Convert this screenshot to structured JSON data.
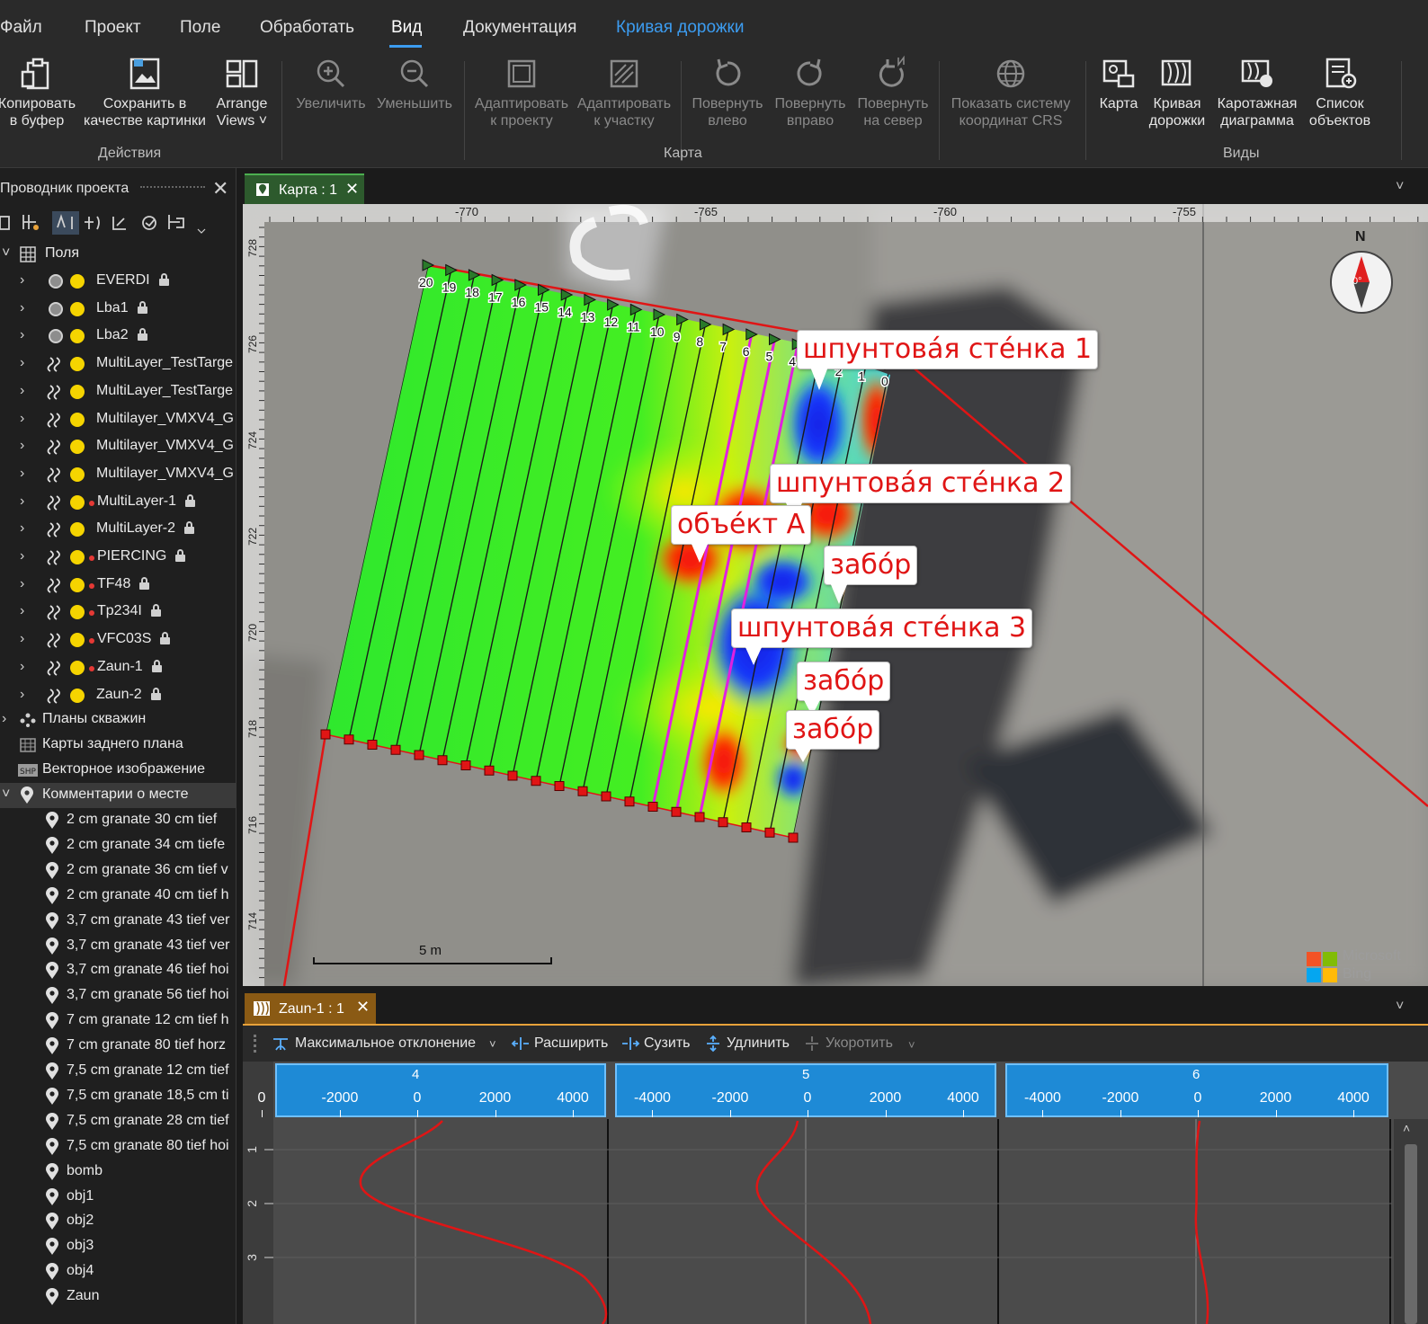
{
  "menu": {
    "items": [
      "Файл",
      "Проект",
      "Поле",
      "Обработать",
      "Вид",
      "Документация",
      "Кривая дорожки"
    ],
    "active": "Вид",
    "accent": "Кривая дорожки"
  },
  "ribbon": {
    "actions": {
      "copy": "Копировать\nв буфер",
      "save_image": "Сохранить в\nкачестве картинки",
      "arrange": "Arrange\nViews ˅",
      "group": "Действия"
    },
    "map": {
      "zoom_in": "Увеличить",
      "zoom_out": "Уменьшить",
      "fit_project": "Адаптировать\nк проекту",
      "fit_field": "Адаптировать\nк участку",
      "rotate_left": "Повернуть\nвлево",
      "rotate_right": "Повернуть\nвправо",
      "rotate_north": "Повернуть\nна север",
      "show_crs": "Показать систему\nкоординат CRS",
      "group": "Карта"
    },
    "views": {
      "map": "Карта",
      "track_curve": "Кривая\nдорожки",
      "log_chart": "Каротажная\nдиаграмма",
      "object_list": "Список\nобъектов",
      "group": "Виды"
    }
  },
  "sidebar": {
    "title": "Проводник проекта",
    "fields_label": "Поля",
    "fields": [
      {
        "name": "EVERDI",
        "kind": "grid",
        "red": false,
        "locked": true
      },
      {
        "name": "Lba1",
        "kind": "grid",
        "red": false,
        "locked": true
      },
      {
        "name": "Lba2",
        "kind": "grid",
        "red": false,
        "locked": true
      },
      {
        "name": "MultiLayer_TestTarge",
        "kind": "wave",
        "red": false,
        "locked": false
      },
      {
        "name": "MultiLayer_TestTarge",
        "kind": "wave",
        "red": false,
        "locked": false
      },
      {
        "name": "Multilayer_VMXV4_G",
        "kind": "wave",
        "red": false,
        "locked": false
      },
      {
        "name": "Multilayer_VMXV4_G",
        "kind": "wave",
        "red": false,
        "locked": false
      },
      {
        "name": "Multilayer_VMXV4_G",
        "kind": "wave",
        "red": false,
        "locked": false
      },
      {
        "name": "MultiLayer-1",
        "kind": "wave",
        "red": true,
        "locked": true
      },
      {
        "name": "MultiLayer-2",
        "kind": "wave",
        "red": false,
        "locked": true
      },
      {
        "name": "PIERCING",
        "kind": "wave",
        "red": true,
        "locked": true
      },
      {
        "name": "TF48",
        "kind": "wave",
        "red": true,
        "locked": true
      },
      {
        "name": "Tp234I",
        "kind": "wave",
        "red": true,
        "locked": true
      },
      {
        "name": "VFC03S",
        "kind": "wave",
        "red": true,
        "locked": true
      },
      {
        "name": "Zaun-1",
        "kind": "wave",
        "red": true,
        "locked": true
      },
      {
        "name": "Zaun-2",
        "kind": "wave",
        "red": false,
        "locked": true
      }
    ],
    "boreholes": "Планы скважин",
    "backgrounds": "Карты заднего плана",
    "vector": "Векторное изображение",
    "comments_label": "Комментарии о месте",
    "comments": [
      "2  cm granate 30 cm tief",
      "2  cm granate 34 cm tiefe",
      "2 cm granate 36 cm tief v",
      "2 cm granate 40 cm tief h",
      "3,7 cm granate 43 tief ver",
      "3,7 cm granate 43 tief ver",
      "3,7 cm granate 46 tief hoi",
      "3,7 cm granate 56 tief hoi",
      "7 cm granate 12 cm tief h",
      "7 cm granate 80 tief horz",
      "7,5 cm granate 12 cm tief",
      "7,5 cm granate 18,5 cm ti",
      "7,5 cm granate 28 cm tief",
      "7,5 cm granate 80 tief hoi",
      "bomb",
      "obj1",
      "obj2",
      "obj3",
      "obj4",
      "Zaun"
    ]
  },
  "map_panel": {
    "tab": "Карта : 1",
    "ruler_top": [
      "-770",
      "-765",
      "-760",
      "-755"
    ],
    "ruler_left": [
      "728",
      "726",
      "724",
      "722",
      "720",
      "718",
      "716",
      "714"
    ],
    "track_numbers": [
      "20",
      "19",
      "18",
      "17",
      "16",
      "15",
      "14",
      "13",
      "12",
      "11",
      "10",
      "9",
      "8",
      "7",
      "6",
      "5",
      "4",
      "3",
      "2",
      "1",
      "0"
    ],
    "compass_n": "N",
    "compass_deg": "0°",
    "scale_label": "5 m",
    "attribution": [
      "Microsoft",
      "Bing"
    ],
    "callouts": [
      {
        "text": "шпунтовáя стéнка 1"
      },
      {
        "text": "шпунтовáя стéнка 2"
      },
      {
        "text": "объéкт А"
      },
      {
        "text": "забóр"
      },
      {
        "text": "шпунтовáя стéнка 3"
      },
      {
        "text": "забóр"
      },
      {
        "text": "забóр"
      }
    ]
  },
  "log_panel": {
    "tab": "Zaun-1 : 1",
    "toolbar": {
      "max_dev": "Максимальное отклонение",
      "expand": "Расширить",
      "narrow": "Сузить",
      "lengthen": "Удлинить",
      "shorten": "Укоротить"
    },
    "tracks": [
      {
        "id": "4",
        "ticks": [
          "0",
          "-2000",
          "0",
          "2000",
          "4000"
        ]
      },
      {
        "id": "5",
        "ticks": [
          "-4000",
          "-2000",
          "0",
          "2000",
          "4000"
        ]
      },
      {
        "id": "6",
        "ticks": [
          "-4000",
          "-2000",
          "0",
          "2000",
          "4000"
        ]
      }
    ],
    "depth_ticks": [
      "1",
      "2",
      "3"
    ]
  }
}
